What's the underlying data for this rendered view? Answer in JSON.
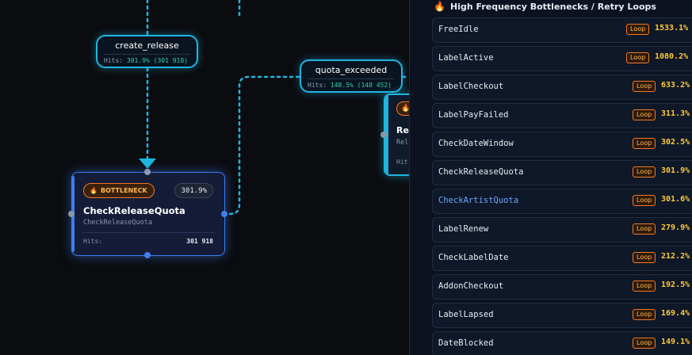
{
  "flow": {
    "edge_labels": [
      {
        "name": "create_release",
        "hits_label": "Hits:",
        "hits_value": "301.9% (301 918)"
      },
      {
        "name": "quota_exceeded",
        "hits_label": "Hits:",
        "hits_value": "148.5% (148 452)"
      }
    ],
    "node_main": {
      "badge": "BOTTLENECK",
      "badge_icon": "flame-icon",
      "percent": "301.9%",
      "title": "CheckReleaseQuota",
      "subtitle": "CheckReleaseQuota",
      "hits_label": "Hits:",
      "hits_value": "301 918"
    },
    "node_right": {
      "badge_icon": "flame-icon",
      "title": "Rel",
      "subtitle": "Rel",
      "hits_label": "Hit"
    }
  },
  "panel": {
    "title": "High Frequency Bottlenecks / Retry Loops",
    "title_icon": "flame-icon",
    "loop_label": "Loop",
    "items": [
      {
        "name": "FreeIdle",
        "rate": "1533.1%",
        "highlight": false
      },
      {
        "name": "LabelActive",
        "rate": "1080.2%",
        "highlight": false
      },
      {
        "name": "LabelCheckout",
        "rate": "633.2%",
        "highlight": false
      },
      {
        "name": "LabelPayFailed",
        "rate": "311.3%",
        "highlight": false
      },
      {
        "name": "CheckDateWindow",
        "rate": "302.5%",
        "highlight": false
      },
      {
        "name": "CheckReleaseQuota",
        "rate": "301.9%",
        "highlight": false
      },
      {
        "name": "CheckArtistQuota",
        "rate": "301.6%",
        "highlight": true
      },
      {
        "name": "LabelRenew",
        "rate": "279.9%",
        "highlight": false
      },
      {
        "name": "CheckLabelDate",
        "rate": "212.2%",
        "highlight": false
      },
      {
        "name": "AddonCheckout",
        "rate": "192.5%",
        "highlight": false
      },
      {
        "name": "LabelLapsed",
        "rate": "169.4%",
        "highlight": false
      },
      {
        "name": "DateBlocked",
        "rate": "149.1%",
        "highlight": false
      }
    ]
  },
  "colors": {
    "edge": "#1fb6e0",
    "node_border": "#3f7df0",
    "badge": "#f07a24",
    "rate": "#ffca3a",
    "highlight": "#6aa6ff"
  }
}
